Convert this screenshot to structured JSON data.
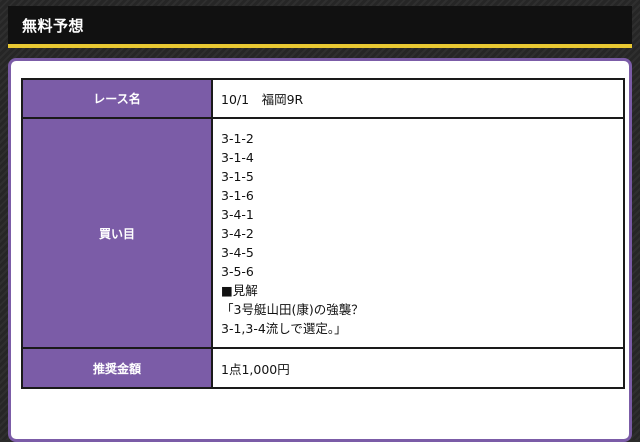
{
  "header": {
    "title": "無料予想"
  },
  "table": {
    "race": {
      "label": "レース名",
      "value": "10/1　福岡9R"
    },
    "bets": {
      "label": "買い目",
      "lines": [
        "3-1-2",
        "3-1-4",
        "3-1-5",
        "3-1-6",
        "3-4-1",
        "3-4-2",
        "3-4-5",
        "3-5-6",
        "■見解",
        "「3号艇山田(康)の強襲？",
        "3-1,3-4流しで選定。」"
      ]
    },
    "amount": {
      "label": "推奨金額",
      "value": "1点1,000円"
    }
  },
  "colors": {
    "accent_purple": "#7b5ca7",
    "header_bg": "#111111",
    "header_underline": "#e8c832"
  }
}
